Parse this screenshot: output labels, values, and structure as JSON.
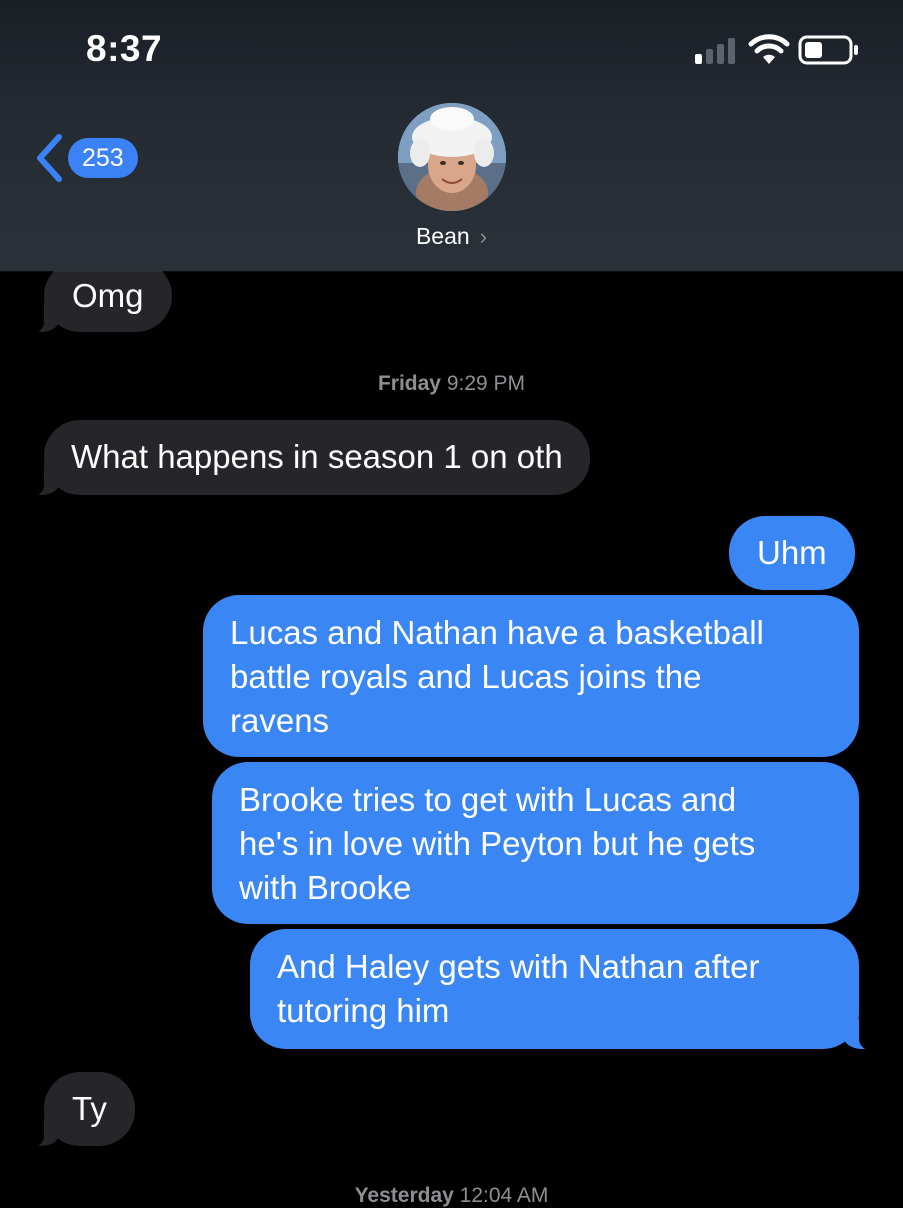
{
  "status_bar": {
    "time": "8:37"
  },
  "nav": {
    "back_count": "253",
    "contact_name": "Bean"
  },
  "messages": {
    "m1": "Omg",
    "ts1_day": "Friday",
    "ts1_time": "9:29 PM",
    "m2": "What happens in season 1 on oth",
    "m3": "Uhm",
    "m4_l1": "Lucas and Nathan have a basketball",
    "m4_l2": "battle royals and Lucas joins the",
    "m4_l3": "ravens",
    "m5_l1": "Brooke tries to get with Lucas and",
    "m5_l2": "he's in love with Peyton but he gets",
    "m5_l3": "with Brooke",
    "m6_l1": "And Haley gets with Nathan after",
    "m6_l2": "tutoring him",
    "m7": "Ty",
    "ts2_day": "Yesterday",
    "ts2_time": "12:04 AM"
  },
  "colors": {
    "incoming_bubble": "#26262a",
    "outgoing_bubble": "#3a86f5",
    "accent": "#3b82f6",
    "timestamp": "#8e8e93"
  },
  "icons": [
    "signal-icon",
    "wifi-icon",
    "battery-icon",
    "back-chevron-icon",
    "chevron-right-icon"
  ]
}
